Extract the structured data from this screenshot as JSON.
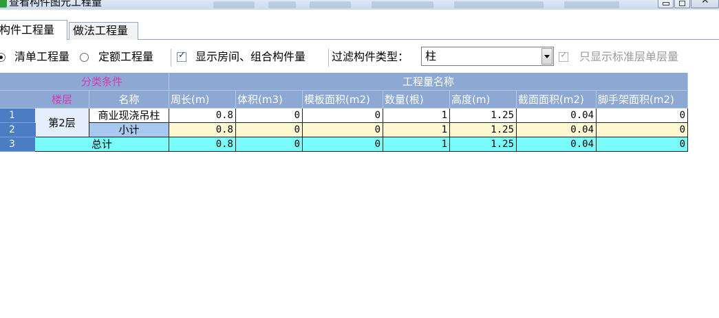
{
  "window": {
    "title": "查看构件图元工程量"
  },
  "tabs": [
    {
      "label": "构件工程量",
      "active": true
    },
    {
      "label": "做法工程量",
      "active": false
    }
  ],
  "filters": {
    "radio_bill_label": "清单工程量",
    "radio_bill_selected": true,
    "radio_quota_label": "定额工程量",
    "radio_quota_selected": false,
    "show_room_label": "显示房间、组合构件量",
    "show_room_checked": true,
    "type_filter_label": "过滤构件类型：",
    "type_filter_value": "柱",
    "std_floor_label": "只显示标准层单层量",
    "std_floor_checked": true,
    "std_floor_disabled": true
  },
  "table": {
    "group_category": "分类条件",
    "group_quantity": "工程量名称",
    "col_floor": "楼层",
    "col_name": "名称",
    "columns": [
      "周长(m)",
      "体积(m3)",
      "模板面积(m2)",
      "数量(根)",
      "高度(m)",
      "截面面积(m2)",
      "脚手架面积(m2)"
    ],
    "rows": [
      {
        "num": "1",
        "floor": "第2层",
        "name": "商业现浇吊柱",
        "values": [
          "0.8",
          "0",
          "0",
          "1",
          "1.25",
          "0.04",
          "0"
        ]
      },
      {
        "num": "2",
        "floor": "第2层",
        "name": "小计",
        "values": [
          "0.8",
          "0",
          "0",
          "1",
          "1.25",
          "0.04",
          "0"
        ]
      },
      {
        "num": "3",
        "name": "总计",
        "values": [
          "0.8",
          "0",
          "0",
          "1",
          "1.25",
          "0.04",
          "0"
        ]
      }
    ]
  },
  "colors": {
    "header_bg": "#8ea8d4",
    "row_number_bg": "#4c7dc4",
    "category_text": "#d23bb5",
    "subtotal_bg": "#fdf8d2",
    "total_bg": "#79fbfa"
  }
}
